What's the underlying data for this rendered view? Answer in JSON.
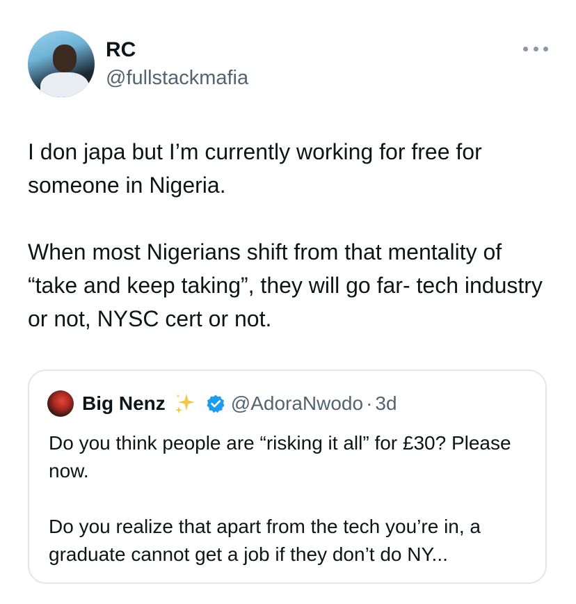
{
  "author": {
    "name": "RC",
    "handle": "@fullstackmafia"
  },
  "tweet": {
    "paragraphs": [
      "I don japa but I’m currently working for free for someone in Nigeria.",
      "When most Nigerians shift from that mentality of “take and keep taking”, they will go far- tech industry or not, NYSC cert or not."
    ]
  },
  "quote": {
    "name": "Big Nenz",
    "handle": "@AdoraNwodo",
    "separator": "·",
    "time": "3d",
    "paragraphs": [
      "Do you think people are “risking it all” for £30? Please now.",
      "Do you realize that apart from the tech you’re in, a graduate cannot get a job if they don’t do NY..."
    ]
  },
  "icons": {
    "more": "more-options-icon",
    "sparkle": "sparkles-icon",
    "verified": "verified-badge-icon"
  },
  "colors": {
    "verified_badge": "#1d9bf0",
    "secondary_text": "#536471",
    "sparkle": "#f4c842"
  }
}
